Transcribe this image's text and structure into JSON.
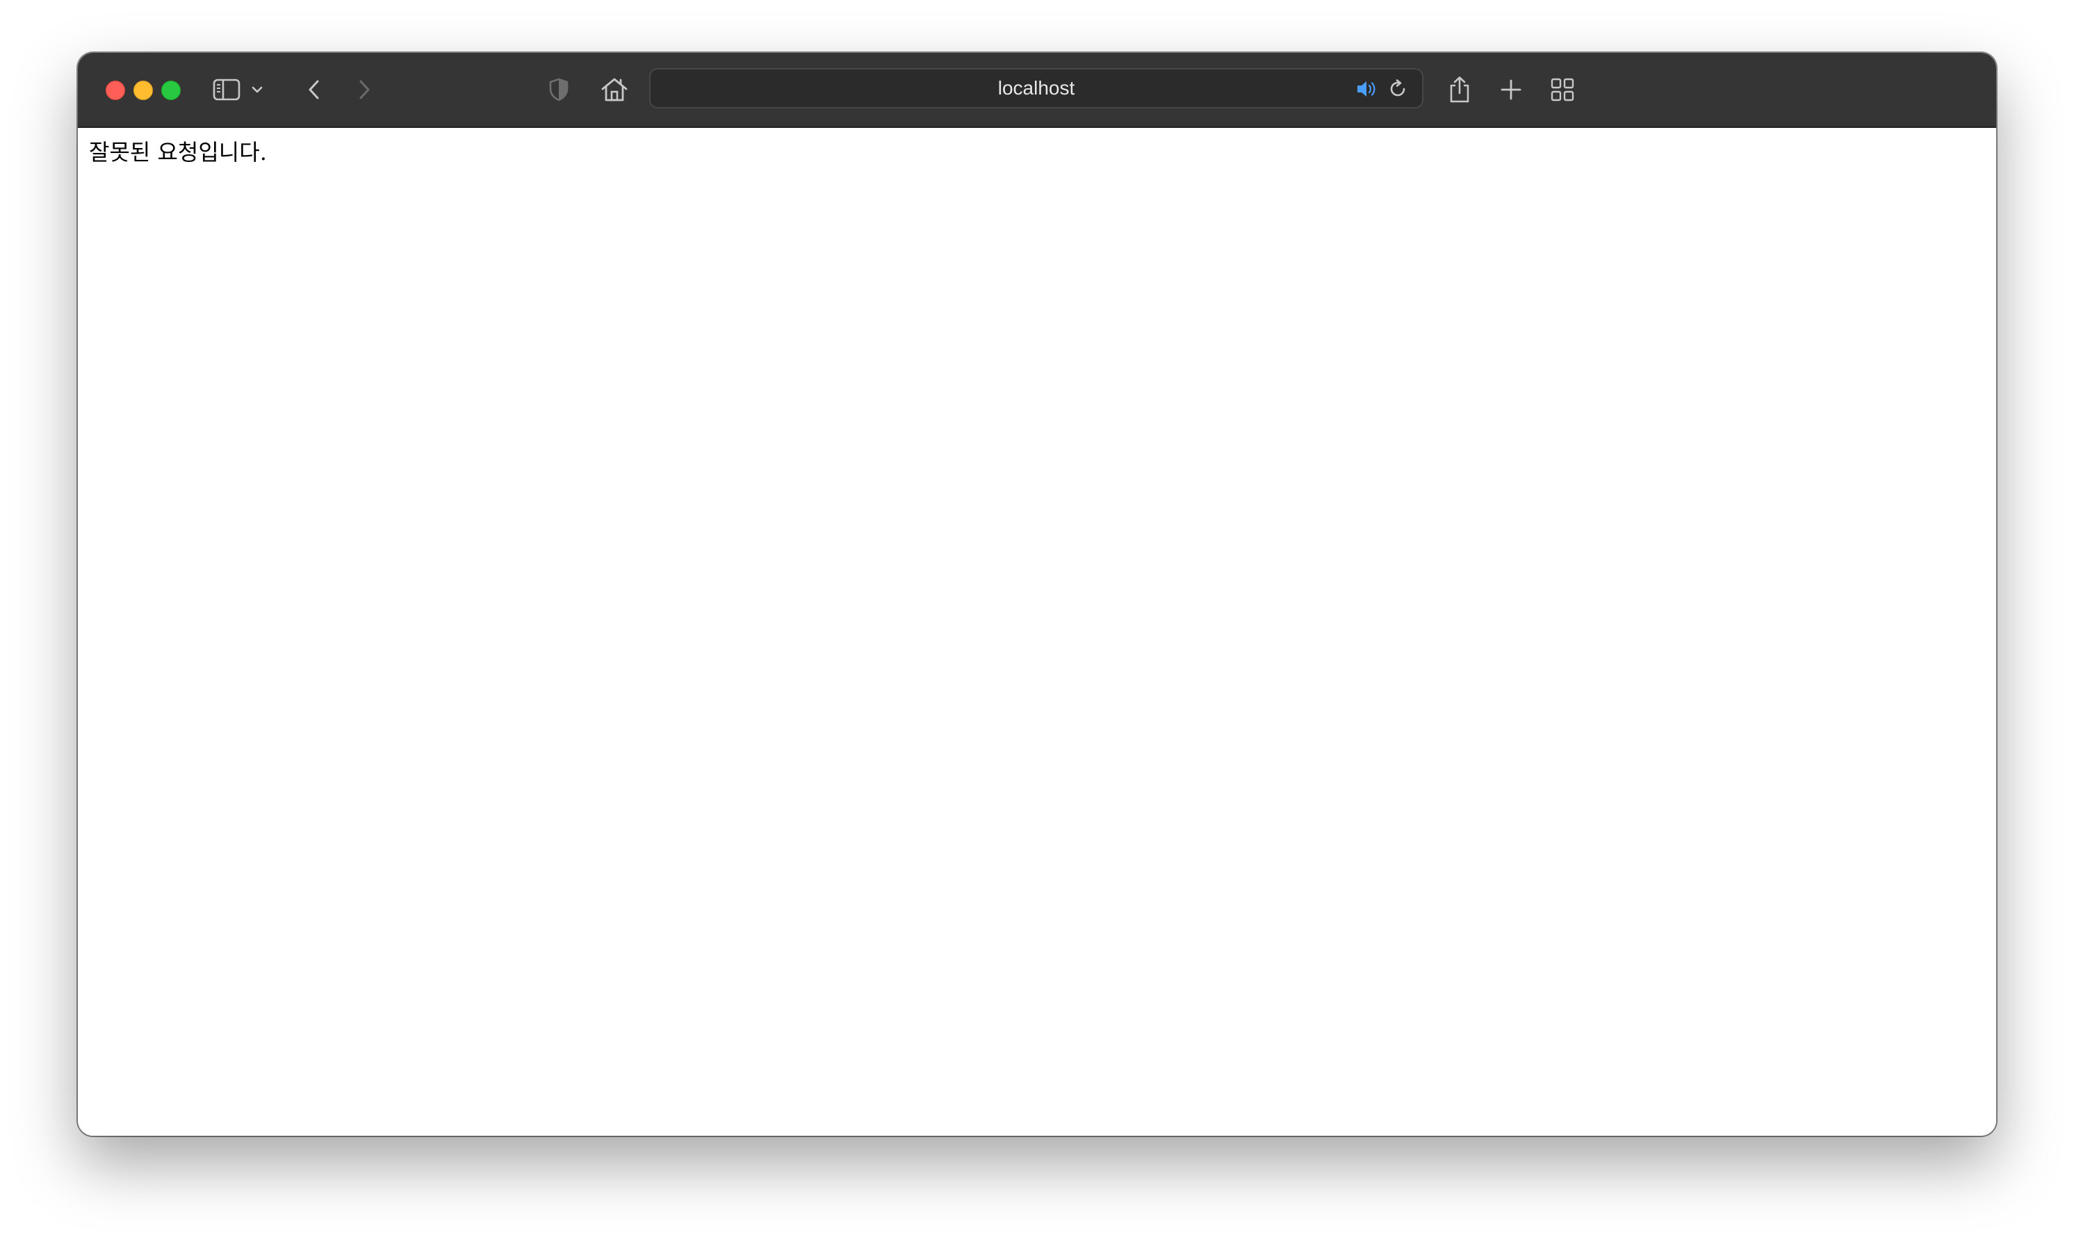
{
  "browser": {
    "address_bar": {
      "url": "localhost"
    },
    "icons": {
      "sidebar": "sidebar-icon",
      "sidebar_menu": "chevron-down-icon",
      "back": "chevron-left-icon",
      "forward": "chevron-right-icon",
      "privacy": "shield-icon",
      "home": "home-icon",
      "audio": "speaker-icon",
      "reload": "reload-icon",
      "share": "share-icon",
      "new_tab": "plus-icon",
      "tab_overview": "grid-icon"
    },
    "colors": {
      "toolbar": "#353535",
      "audio_accent": "#4a9eff",
      "close": "#ff5f57",
      "minimize": "#febc2e",
      "zoom": "#28c840"
    }
  },
  "page": {
    "message": "잘못된 요청입니다."
  }
}
